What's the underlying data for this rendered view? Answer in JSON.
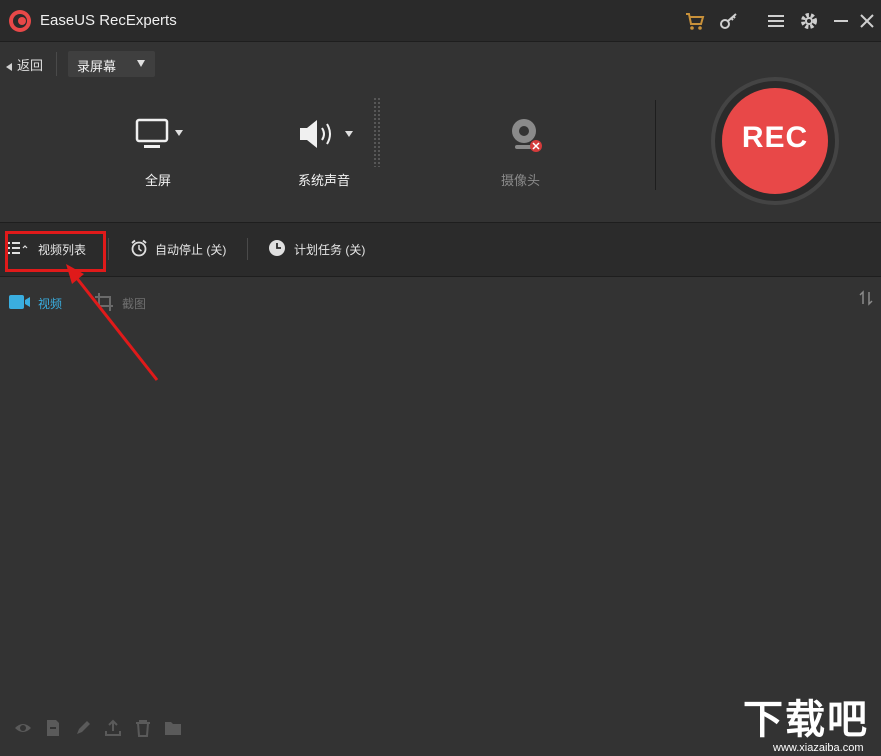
{
  "app": {
    "title": "EaseUS RecExperts",
    "accent": "#e84848"
  },
  "titlebar": {
    "icons": [
      "cart-icon",
      "key-icon",
      "menu-icon",
      "gear-icon",
      "minimize-icon",
      "close-icon"
    ]
  },
  "toolbar": {
    "back_label": "返回",
    "mode_label": "录屏幕"
  },
  "options": {
    "screen_label": "全屏",
    "audio_label": "系统声音",
    "webcam_label": "摄像头"
  },
  "rec_label": "REC",
  "panelbar": {
    "video_list_label": "视频列表",
    "auto_stop_label": "自动停止 (关)",
    "schedule_label": "计划任务 (关)"
  },
  "tabs": {
    "video_label": "视频",
    "screenshot_label": "截图"
  },
  "bottom_icons": [
    "eye-icon",
    "file-icon",
    "edit-icon",
    "upload-icon",
    "trash-icon",
    "folder-icon"
  ],
  "watermark": {
    "big": "下载吧",
    "small": "www.xiazaiba.com"
  }
}
